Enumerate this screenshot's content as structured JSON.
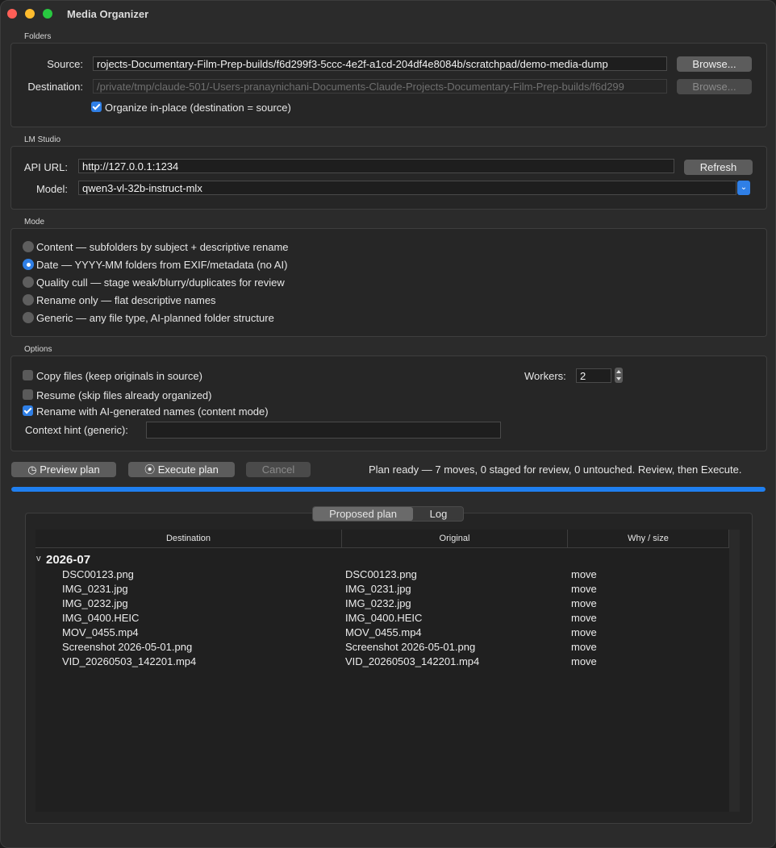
{
  "window": {
    "title": "Media Organizer"
  },
  "folders": {
    "section": "Folders",
    "source_label": "Source:",
    "source_value": "rojects-Documentary-Film-Prep-builds/f6d299f3-5ccc-4e2f-a1cd-204df4e8084b/scratchpad/demo-media-dump",
    "destination_label": "Destination:",
    "destination_value": "/private/tmp/claude-501/-Users-pranaynichani-Documents-Claude-Projects-Documentary-Film-Prep-builds/f6d299",
    "browse_label": "Browse...",
    "inplace_label": "Organize in-place (destination = source)"
  },
  "lmstudio": {
    "section": "LM Studio",
    "api_label": "API URL:",
    "api_value": "http://127.0.0.1:1234",
    "refresh_label": "Refresh",
    "model_label": "Model:",
    "model_value": "qwen3-vl-32b-instruct-mlx"
  },
  "mode": {
    "section": "Mode",
    "options": [
      "Content — subfolders by subject + descriptive rename",
      "Date — YYYY-MM folders from EXIF/metadata (no AI)",
      "Quality cull — stage weak/blurry/duplicates for review",
      "Rename only — flat descriptive names",
      "Generic — any file type, AI-planned folder structure"
    ],
    "selected_index": 1
  },
  "options": {
    "section": "Options",
    "copy_label": "Copy files (keep originals in source)",
    "resume_label": "Resume (skip files already organized)",
    "rename_label": "Rename with AI-generated names (content mode)",
    "context_label": "Context hint (generic):",
    "context_value": "",
    "workers_label": "Workers:",
    "workers_value": "2"
  },
  "actions": {
    "preview_label": "Preview plan",
    "execute_label": "Execute plan",
    "cancel_label": "Cancel",
    "status": "Plan ready — 7 moves, 0 staged for review, 0 untouched. Review, then Execute.",
    "progress_fraction": 1.0
  },
  "tabs": [
    "Proposed plan",
    "Log"
  ],
  "table": {
    "columns": [
      "Destination",
      "Original",
      "Why / size"
    ],
    "group": "2026-07",
    "rows": [
      {
        "destination": "DSC00123.png",
        "original": "DSC00123.png",
        "why": "move"
      },
      {
        "destination": "IMG_0231.jpg",
        "original": "IMG_0231.jpg",
        "why": "move"
      },
      {
        "destination": "IMG_0232.jpg",
        "original": "IMG_0232.jpg",
        "why": "move"
      },
      {
        "destination": "IMG_0400.HEIC",
        "original": "IMG_0400.HEIC",
        "why": "move"
      },
      {
        "destination": "MOV_0455.mp4",
        "original": "MOV_0455.mp4",
        "why": "move"
      },
      {
        "destination": "Screenshot 2026-05-01.png",
        "original": "Screenshot 2026-05-01.png",
        "why": "move"
      },
      {
        "destination": "VID_20260503_142201.mp4",
        "original": "VID_20260503_142201.mp4",
        "why": "move"
      }
    ]
  }
}
